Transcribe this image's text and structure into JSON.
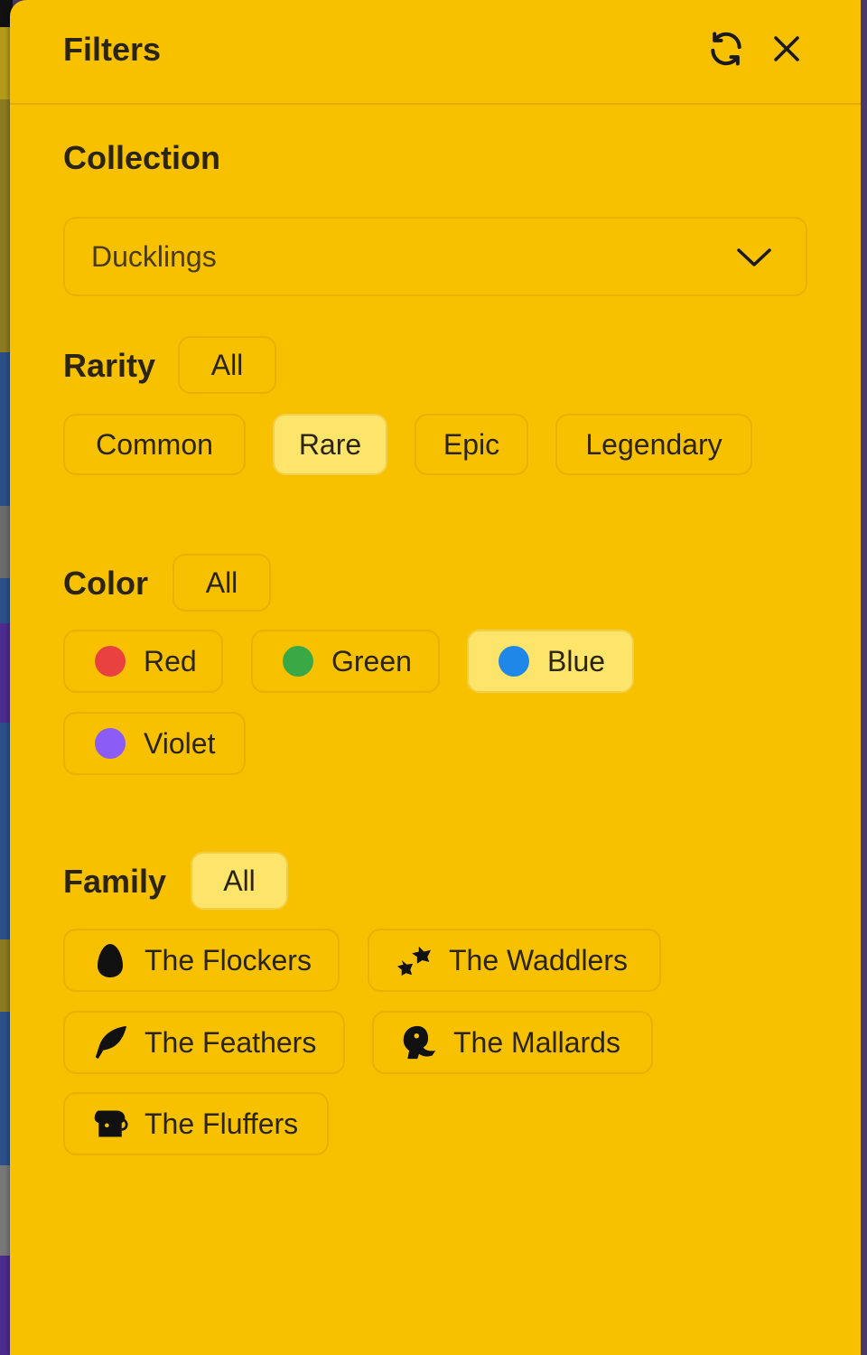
{
  "header": {
    "title": "Filters"
  },
  "collection": {
    "title": "Collection",
    "selected": "Ducklings"
  },
  "rarity": {
    "title": "Rarity",
    "all_label": "All",
    "options": [
      {
        "label": "Common",
        "selected": false
      },
      {
        "label": "Rare",
        "selected": true
      },
      {
        "label": "Epic",
        "selected": false
      },
      {
        "label": "Legendary",
        "selected": false
      }
    ]
  },
  "color": {
    "title": "Color",
    "all_label": "All",
    "options": [
      {
        "label": "Red",
        "swatch": "#e94040",
        "selected": false
      },
      {
        "label": "Green",
        "swatch": "#3aa845",
        "selected": false
      },
      {
        "label": "Blue",
        "swatch": "#1f87e8",
        "selected": true
      },
      {
        "label": "Violet",
        "swatch": "#8b5cf6",
        "selected": false
      }
    ]
  },
  "family": {
    "title": "Family",
    "all_label": "All",
    "all_selected": true,
    "options": [
      {
        "label": "The Flockers",
        "icon": "egg-icon"
      },
      {
        "label": "The Waddlers",
        "icon": "footprints-icon"
      },
      {
        "label": "The Feathers",
        "icon": "feather-icon"
      },
      {
        "label": "The Mallards",
        "icon": "duck-head-icon"
      },
      {
        "label": "The Fluffers",
        "icon": "bread-icon"
      }
    ]
  },
  "colors": {
    "panel": "#f7c100",
    "chip_border": "#e9b200",
    "chip_selected": "#fde46a"
  }
}
